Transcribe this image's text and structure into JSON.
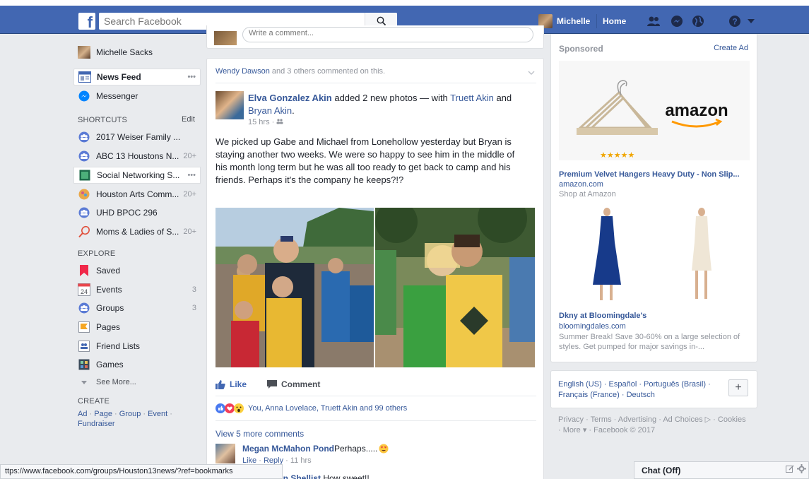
{
  "topbar": {
    "search_placeholder": "Search Facebook",
    "user_name": "Michelle",
    "home_label": "Home"
  },
  "left": {
    "profile_name": "Michelle Sacks",
    "news_feed": "News Feed",
    "news_feed_more": "•••",
    "messenger": "Messenger",
    "shortcuts_heading": "SHORTCUTS",
    "shortcuts_edit": "Edit",
    "shortcuts": [
      {
        "label": "2017 Weiser Family ...",
        "count": ""
      },
      {
        "label": "ABC 13 Houstons N...",
        "count": "20+"
      },
      {
        "label": "Social Networking S...",
        "count": "•••"
      },
      {
        "label": "Houston Arts Comm...",
        "count": "20+"
      },
      {
        "label": "UHD BPOC 296",
        "count": ""
      },
      {
        "label": "Moms & Ladies of S...",
        "count": "20+"
      }
    ],
    "explore_heading": "EXPLORE",
    "explore": [
      {
        "label": "Saved",
        "count": ""
      },
      {
        "label": "Events",
        "count": "3",
        "icon_text": "24"
      },
      {
        "label": "Groups",
        "count": "3"
      },
      {
        "label": "Pages",
        "count": ""
      },
      {
        "label": "Friend Lists",
        "count": ""
      },
      {
        "label": "Games",
        "count": ""
      }
    ],
    "see_more": "See More...",
    "create_heading": "CREATE",
    "create_links": [
      "Ad",
      "Page",
      "Group",
      "Event",
      "Fundraiser"
    ]
  },
  "feed": {
    "comment_placeholder": "Write a comment...",
    "activity_actor": "Wendy Dawson",
    "activity_text": " and 3 others commented on this.",
    "post_author": "Elva Gonzalez Akin",
    "post_action": " added 2 new photos — with ",
    "tag1": "Truett Akin",
    "and_text": " and ",
    "tag2": "Bryan Akin",
    "post_time": "15 hrs · ",
    "post_text": "We picked up Gabe and Michael from Lonehollow yesterday but Bryan is staying another two weeks. We were so happy to see him in the middle of his month long term but he was all too ready to get back to camp and his friends. Perhaps it's the company he keeps?!?",
    "like_label": "Like",
    "comment_label": "Comment",
    "reactions_text": "You, Anna Lovelace, Truett Akin and 99 others",
    "view_more": "View 5 more comments",
    "comment1_author": "Megan McMahon Pond",
    "comment1_text": " Perhaps.....",
    "comment1_like": "Like",
    "comment1_reply": "Reply",
    "comment1_time": "11 hrs",
    "comment2_author": "ullivan Shellist",
    "comment2_text": " How sweet!!"
  },
  "right": {
    "sponsored": "Sponsored",
    "create_ad": "Create Ad",
    "ad1_brand": "amazon",
    "ad1_title": "Premium Velvet Hangers Heavy Duty - Non Slip...",
    "ad1_domain": "amazon.com",
    "ad1_desc": "Shop at Amazon",
    "ad2_title": "Dkny at Bloomingdale's",
    "ad2_domain": "bloomingdales.com",
    "ad2_desc": "Summer Break! Save 30-60% on a large selection of styles. Get pumped for major savings in-...",
    "languages": "English (US) · Español · Português (Brasil) · Français (France) · Deutsch",
    "lang_add": "+",
    "footer": "Privacy · Terms · Advertising · Ad Choices ▷ · Cookies · More ▾ · Facebook © 2017"
  },
  "statusbar": {
    "url": "ttps://www.facebook.com/groups/Houston13news/?ref=bookmarks"
  },
  "chat": {
    "label": "Chat (Off)"
  }
}
